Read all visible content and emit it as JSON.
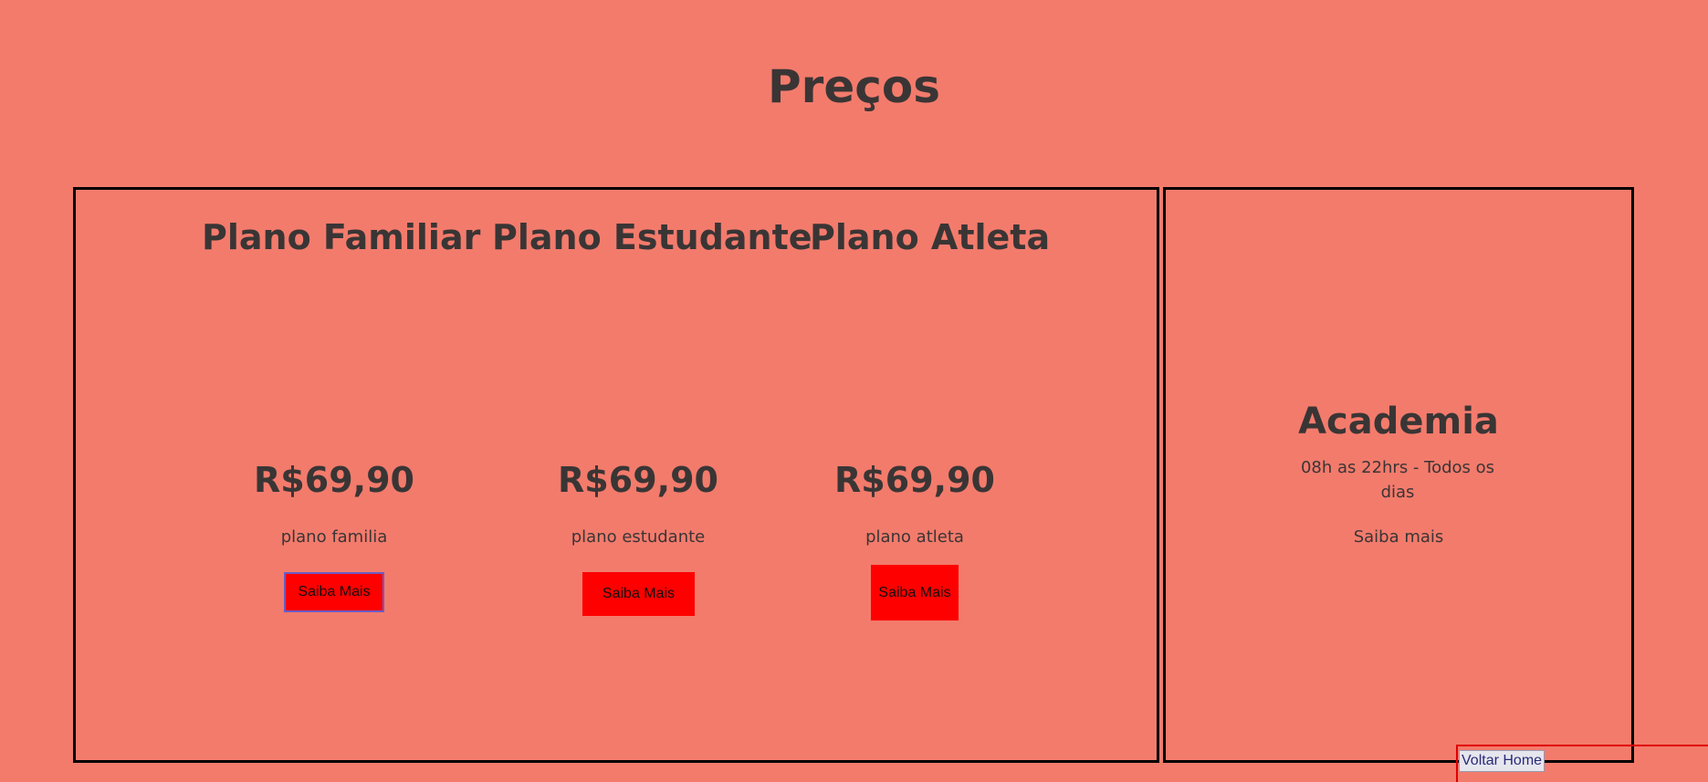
{
  "page": {
    "title": "Preços"
  },
  "plans": [
    {
      "title": "Plano Familiar",
      "price": "R$69,90",
      "description": "plano familia",
      "button_label": "Saiba Mais"
    },
    {
      "title": "Plano Estudante",
      "price": "R$69,90",
      "description": "plano estudante",
      "button_label": "Saiba Mais"
    },
    {
      "title": "Plano Atleta",
      "price": "R$69,90",
      "description": "plano atleta",
      "button_label": "Saiba Mais"
    }
  ],
  "academia": {
    "title": "Academia",
    "hours": "08h as 22hrs - Todos os dias",
    "link_label": "Saiba mais"
  },
  "footer": {
    "home_link_label": "Voltar Home"
  },
  "colors": {
    "background": "#f37b6c",
    "button": "#ff0000",
    "text": "#3a3535"
  }
}
